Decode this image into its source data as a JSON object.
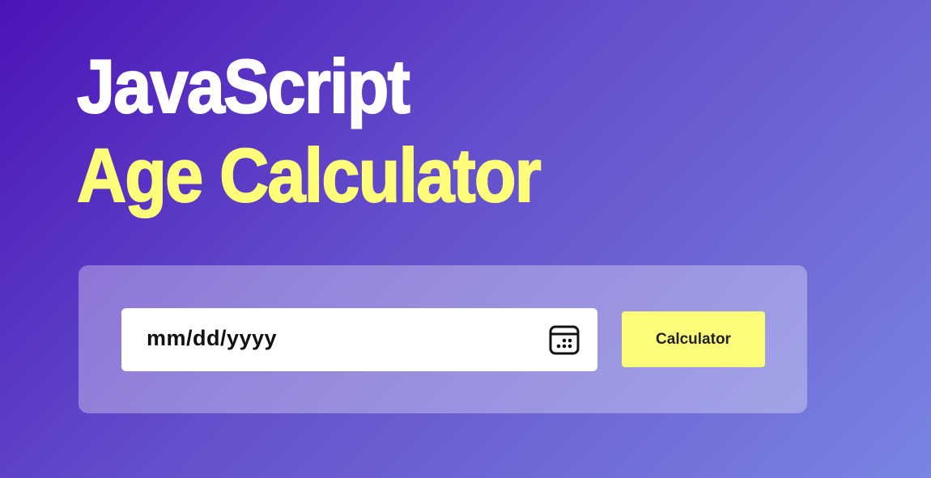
{
  "heading": {
    "line1": "JavaScript",
    "line2": "Age Calculator"
  },
  "form": {
    "date_placeholder": "mm/dd/yyyy",
    "calendar_icon": "calendar-icon",
    "button_label": "Calculator"
  },
  "colors": {
    "background_start": "#4a14b8",
    "background_end": "#7a84e2",
    "accent_yellow": "#fdfd7a",
    "heading_white": "#ffffff",
    "input_bg": "#ffffff"
  }
}
